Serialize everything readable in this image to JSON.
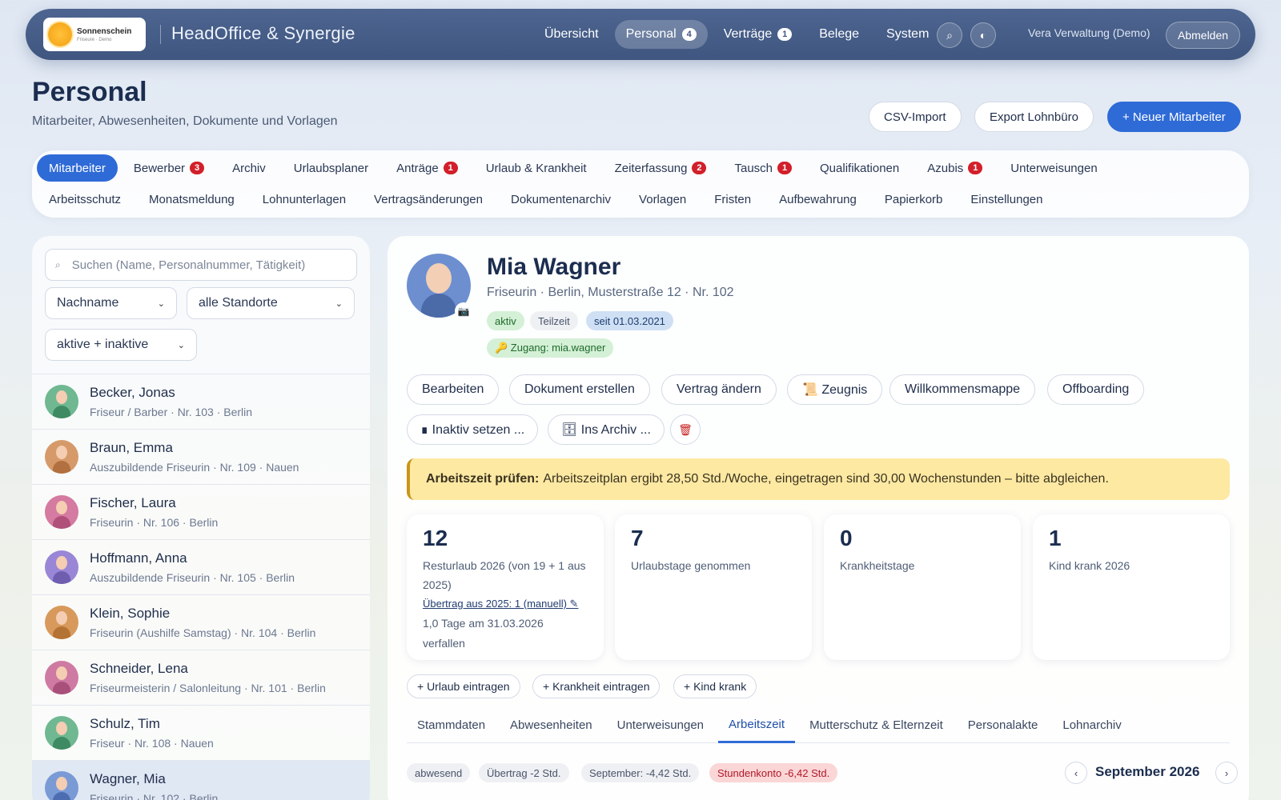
{
  "topbar": {
    "logo_name": "Sonnenschein",
    "logo_sub": "Friseure · Demo",
    "app_title": "HeadOffice & Synergie",
    "nav": [
      {
        "label": "Übersicht",
        "badge": ""
      },
      {
        "label": "Personal",
        "badge": "4"
      },
      {
        "label": "Verträge",
        "badge": "1"
      },
      {
        "label": "Belege",
        "badge": ""
      },
      {
        "label": "System",
        "badge": ""
      }
    ],
    "search_icon": "⌕",
    "theme_icon": "◐",
    "user": "Vera Verwaltung (Demo)",
    "logout": "Abmelden"
  },
  "header": {
    "title": "Personal",
    "subtitle": "Mitarbeiter, Abwesenheiten, Dokumente und Vorlagen",
    "csv": "CSV-Import",
    "export": "Export Lohnbüro",
    "new": "+ Neuer Mitarbeiter"
  },
  "tabs_row1": [
    {
      "label": "Mitarbeiter",
      "badge": ""
    },
    {
      "label": "Bewerber",
      "badge": "3"
    },
    {
      "label": "Archiv",
      "badge": ""
    },
    {
      "label": "Urlaubsplaner",
      "badge": ""
    },
    {
      "label": "Anträge",
      "badge": "1"
    },
    {
      "label": "Urlaub & Krankheit",
      "badge": ""
    },
    {
      "label": "Zeiterfassung",
      "badge": "2"
    },
    {
      "label": "Tausch",
      "badge": "1"
    },
    {
      "label": "Qualifikationen",
      "badge": ""
    },
    {
      "label": "Azubis",
      "badge": "1"
    },
    {
      "label": "Unterweisungen",
      "badge": ""
    }
  ],
  "tabs_row2": [
    "Arbeitsschutz",
    "Monatsmeldung",
    "Lohnunterlagen",
    "Vertragsänderungen",
    "Dokumentenarchiv",
    "Vorlagen",
    "Fristen",
    "Aufbewahrung",
    "Papierkorb",
    "Einstellungen"
  ],
  "sidebar": {
    "search_placeholder": "Suchen (Name, Personalnummer, Tätigkeit)",
    "sort": "Nachname",
    "location": "alle Standorte",
    "status": "aktive + inaktive",
    "employees": [
      {
        "name": "Becker, Jonas",
        "meta": "Friseur / Barber · Nr. 103 · Berlin",
        "bg": "#6fb892",
        "body": "#3e8a62"
      },
      {
        "name": "Braun, Emma",
        "meta": "Auszubildende Friseurin · Nr. 109 · Nauen",
        "bg": "#d69a6a",
        "body": "#b26f40"
      },
      {
        "name": "Fischer, Laura",
        "meta": "Friseurin · Nr. 106 · Berlin",
        "bg": "#d57aa0",
        "body": "#b0507a"
      },
      {
        "name": "Hoffmann, Anna",
        "meta": "Auszubildende Friseurin · Nr. 105 · Berlin",
        "bg": "#9a86d6",
        "body": "#6f5db0"
      },
      {
        "name": "Klein, Sophie",
        "meta": "Friseurin (Aushilfe Samstag) · Nr. 104 · Berlin",
        "bg": "#d89a5c",
        "body": "#b47234"
      },
      {
        "name": "Schneider, Lena",
        "meta": "Friseurmeisterin / Salonleitung · Nr. 101 · Berlin",
        "bg": "#cf7aa2",
        "body": "#a8507a"
      },
      {
        "name": "Schulz, Tim",
        "meta": "Friseur · Nr. 108 · Nauen",
        "bg": "#6fb892",
        "body": "#3e8a62"
      },
      {
        "name": "Wagner, Mia",
        "meta": "Friseurin · Nr. 102 · Berlin",
        "bg": "#7a9ad6",
        "body": "#4d6db0"
      }
    ]
  },
  "profile": {
    "name": "Mia Wagner",
    "sub": "Friseurin · Berlin, Musterstraße 12 · Nr. 102",
    "tag_active": "aktiv",
    "tag_part": "Teilzeit",
    "tag_since": "seit 01.03.2021",
    "access": "🔑 Zugang: mia.wagner",
    "actions": [
      "Bearbeiten",
      "Dokument erstellen",
      "Vertrag ändern",
      "📜 Zeugnis",
      "Willkommensmappe",
      "Offboarding"
    ],
    "inactive": "∎ Inaktiv setzen ...",
    "archive": "🗄 Ins Archiv ...",
    "alert_title": "Arbeitszeit prüfen:",
    "alert_text": "Arbeitszeitplan ergibt 28,50 Std./Woche, eingetragen sind 30,00 Wochenstunden – bitte abgleichen.",
    "stats": [
      {
        "num": "12",
        "label": "Resturlaub 2026 (von 19 + 1 aus 2025)"
      },
      {
        "num": "7",
        "label": "Urlaubstage genommen"
      },
      {
        "num": "0",
        "label": "Krankheitstage"
      },
      {
        "num": "1",
        "label": "Kind krank 2026"
      }
    ],
    "carry_link": "Übertrag aus 2025: 1 (manuell) ✎",
    "carry_expire": "1,0 Tage am 31.03.2026 verfallen",
    "add_vac": "+ Urlaub eintragen",
    "add_sick": "+ Krankheit eintragen",
    "add_child": "+ Kind krank",
    "subtabs": [
      "Stammdaten",
      "Abwesenheiten",
      "Unterweisungen",
      "Arbeitszeit",
      "Mutterschutz & Elternzeit",
      "Personalakte",
      "Lohnarchiv"
    ],
    "chips": [
      "abwesend",
      "Übertrag -2 Std.",
      "September: -4,42 Std.",
      "Stundenkonto -6,42 Std."
    ],
    "month": "September 2026",
    "prev": "‹",
    "next": "›"
  }
}
